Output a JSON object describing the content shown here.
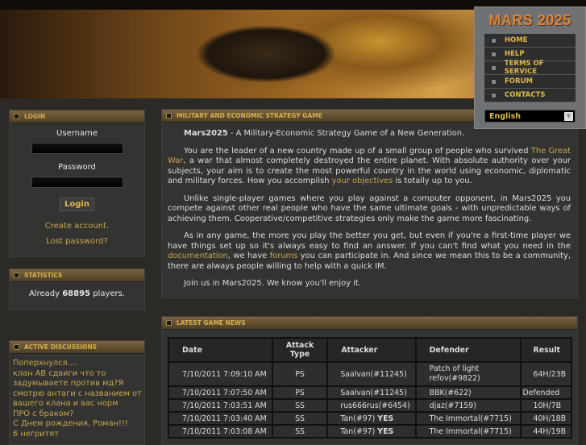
{
  "nav": {
    "logo": "MARS 2025",
    "items": [
      "HOME",
      "HELP",
      "TERMS OF SERVICE",
      "FORUM",
      "CONTACTS"
    ],
    "language": "English"
  },
  "login": {
    "title": "LOGIN",
    "username_label": "Username",
    "password_label": "Password",
    "username_value": "",
    "password_value": "",
    "button": "Login",
    "create": "Create account.",
    "lost": "Lost password?"
  },
  "stats": {
    "title": "STATISTICS",
    "prefix": "Already ",
    "count": "68895",
    "suffix": " players."
  },
  "discussions": {
    "title": "ACTIVE DISCUSSIONS",
    "items": [
      "Поперхнулся....",
      "клан   AB сдвиги что то задумываете против мд?Я смотрю антаги с названием от вашего клана и вас норм",
      "ПРО с браком?",
      "С Днем рождения, Роман!!!",
      "6 негритят"
    ]
  },
  "intro": {
    "title": "MILITARY AND ECONOMIC STRATEGY GAME",
    "p1_bold": "Mars2025",
    "p1": " - A Military-Economic Strategy Game of a New Generation.",
    "p2a": "You are the leader of a new country made up of a small group of people who survived ",
    "p2_link1": "The Great War",
    "p2b": ", a war that almost completely destroyed the entire planet. With absolute authority over your subjects, your aim is to create the most powerful country in the world using economic, diplomatic and military forces. How you accomplish ",
    "p2_link2": "your objectives",
    "p2c": " is totally up to you.",
    "p3": "Unlike single-player games where you play against a computer opponent, in Mars2025 you compete against other real people who have the same ultimate goals - with unpredictable ways of achieving them. Cooperative/competitive strategies only make the game more fascinating.",
    "p4a": "As in any game, the more you play the better you get, but even if you're a first-time player we have things set up so it's always easy to find an answer. If you can't find what you need in the ",
    "p4_link1": "documentation",
    "p4b": ", we have ",
    "p4_link2": "forums",
    "p4c": " you can participate in. And since we mean this to be a community, there are always people willing to help with a quick IM.",
    "p5": "Join us in Mars2025. We know you'll enjoy it."
  },
  "news": {
    "title": "LATEST GAME NEWS",
    "headers": [
      "Date",
      "Attack Type",
      "Attacker",
      "Defender",
      "Result"
    ],
    "rows": [
      {
        "date": "7/10/2011 7:09:10 AM",
        "type": "PS",
        "attacker": "Saalvan(#11245)",
        "yes": "",
        "defender": "Patch of light refov(#9822)",
        "result": "64H/23B"
      },
      {
        "date": "7/10/2011 7:07:50 AM",
        "type": "PS",
        "attacker": "Saalvan(#11245)",
        "yes": "",
        "defender": "BBK(#622)",
        "result": "Defended"
      },
      {
        "date": "7/10/2011 7:03:51 AM",
        "type": "SS",
        "attacker": "rus666rus(#6454)",
        "yes": "",
        "defender": "djaz(#7159)",
        "result": "10H/7B"
      },
      {
        "date": "7/10/2011 7:03:40 AM",
        "type": "SS",
        "attacker": "Tan(#97) ",
        "yes": "YES",
        "defender": "The Immortal(#7715)",
        "result": "40H/18B"
      },
      {
        "date": "7/10/2011 7:03:08 AM",
        "type": "SS",
        "attacker": "Tan(#97) ",
        "yes": "YES",
        "defender": "The Immortal(#7715)",
        "result": "44H/19B"
      }
    ]
  }
}
